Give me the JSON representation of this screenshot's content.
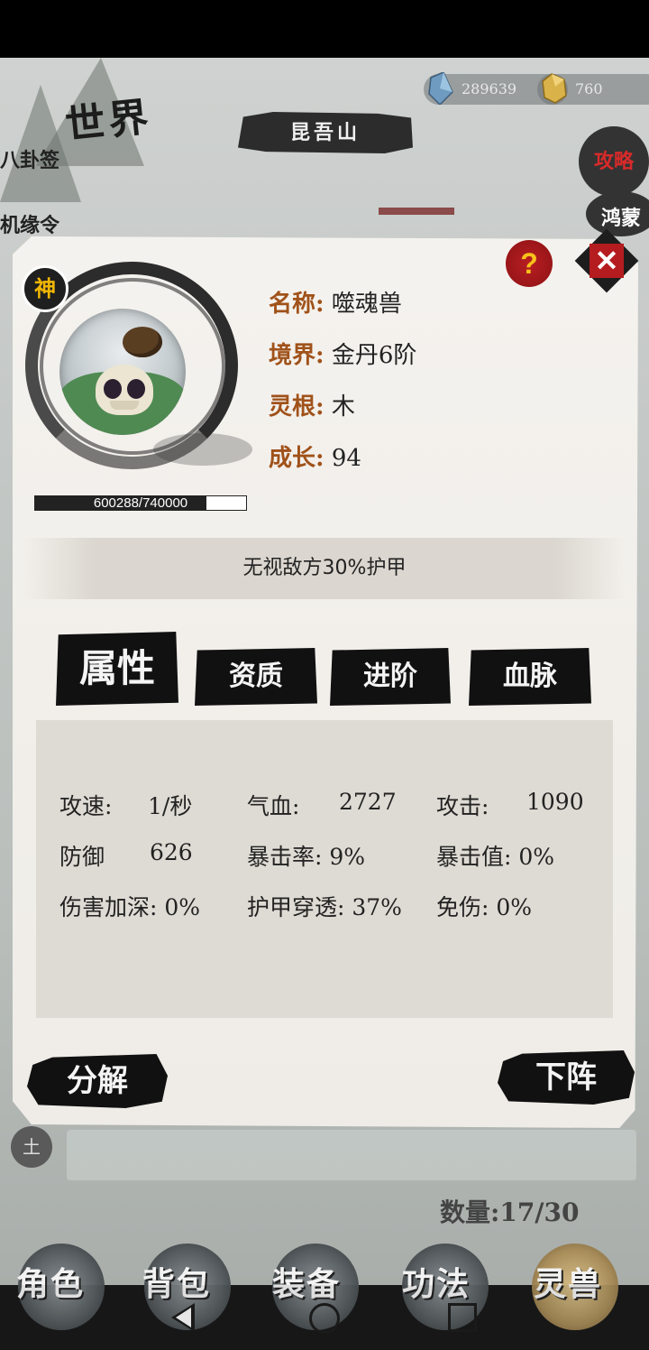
{
  "header": {
    "world_title": "世界",
    "location": "昆吾山",
    "currency": [
      {
        "icon": "crystal-icon",
        "value": "289639"
      },
      {
        "icon": "gold-ingot-icon",
        "value": "760"
      }
    ],
    "left_menu": [
      "八卦签",
      "机缘令"
    ],
    "right_menu": [
      "攻略",
      "鸿蒙"
    ]
  },
  "pet": {
    "tier_badge": "神",
    "exp_text": "600288/740000",
    "exp_current": 600288,
    "exp_max": 740000,
    "info": [
      {
        "key": "名称:",
        "value": "噬魂兽"
      },
      {
        "key": "境界:",
        "value": "金丹6阶"
      },
      {
        "key": "灵根:",
        "value": "木"
      },
      {
        "key": "成长:",
        "value": "94"
      }
    ],
    "skill": "无视敌方30%护甲"
  },
  "modal": {
    "help_label": "?",
    "close_label": "✕"
  },
  "tabs": [
    "属性",
    "资质",
    "进阶",
    "血脉"
  ],
  "attributes": {
    "row1": [
      "攻速:",
      "1/秒",
      "气血:",
      "2727",
      "攻击:",
      "1090"
    ],
    "row2": [
      "防御",
      "626",
      "暴击率: 9%",
      "暴击值: 0%"
    ],
    "row3": [
      "伤害加深: 0%",
      "护甲穿透: 37%",
      "免伤: 0%"
    ]
  },
  "actions": {
    "decompose": "分解",
    "unequip": "下阵"
  },
  "list": {
    "element_badge": "土",
    "count": "数量:17/30"
  },
  "bottom_nav": [
    "角色",
    "背包",
    "装备",
    "功法",
    "灵兽"
  ],
  "colors": {
    "accent_red": "#b51c1f",
    "key_brown": "#a0521a",
    "ink_black": "#111111",
    "help_yellow": "#f7c21a"
  }
}
